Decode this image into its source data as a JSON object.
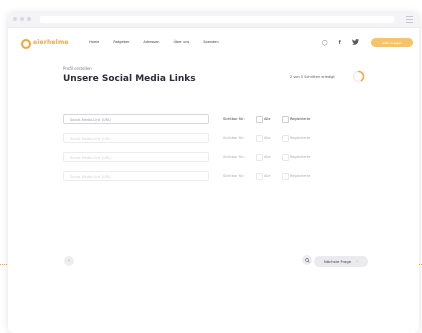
{
  "nav": {
    "brand": "eierhelme",
    "menu": [
      "Home",
      "Ratgeber",
      "Adressen",
      "Über uns",
      "Spenden"
    ],
    "cta_label": "Jetzt loslegen"
  },
  "form": {
    "step_label": "Profil erstellen",
    "title": "Unsere Social Media Links",
    "progress_text": "2 von 5 Schritten erledigt",
    "progress": 0.4,
    "rows": [
      {
        "placeholder": "Social-Media-Link (URL)",
        "visibility_label": "Sichtbar für:",
        "option_all": "Alle",
        "option_registered": "Registrierte"
      },
      {
        "placeholder": "Social-Media-Link (URL)",
        "visibility_label": "Sichtbar für:",
        "option_all": "Alle",
        "option_registered": "Registrierte"
      },
      {
        "placeholder": "Social-Media-Link (URL)",
        "visibility_label": "Sichtbar für:",
        "option_all": "Alle",
        "option_registered": "Registrierte"
      },
      {
        "placeholder": "Social-Media-Link (URL)",
        "visibility_label": "Sichtbar für:",
        "option_all": "Alle",
        "option_registered": "Registrierte"
      }
    ]
  },
  "footer": {
    "next_label": "Nächste Frage"
  },
  "colors": {
    "accent": "#f2a63b",
    "cta": "#f6c26a"
  },
  "icons": {
    "back": "arrow-left-icon",
    "search": "search-icon",
    "next": "arrow-right-icon"
  }
}
